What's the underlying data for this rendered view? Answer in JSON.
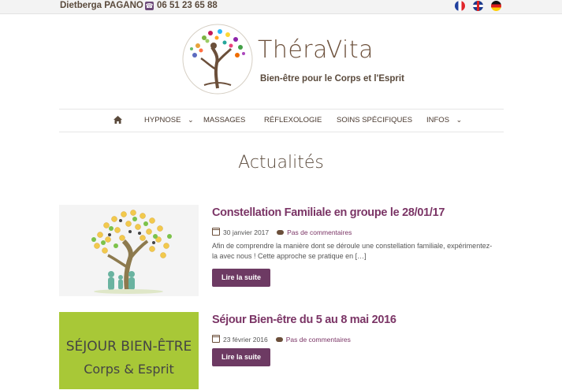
{
  "topbar": {
    "name": "Dietberga PAGANO",
    "phone": "06 51 23 65 88",
    "languages": [
      "Français",
      "English",
      "Deutsch"
    ]
  },
  "brand": {
    "name_part1": "Théra",
    "name_part2": "Vita",
    "tagline": "Bien-être pour le Corps et l'Esprit"
  },
  "nav": {
    "items": [
      {
        "label": "HYPNOSE",
        "has_dropdown": true
      },
      {
        "label": "MASSAGES",
        "has_dropdown": false
      },
      {
        "label": "RÉFLEXOLOGIE",
        "has_dropdown": false
      },
      {
        "label": "SOINS SPÉCIFIQUES",
        "has_dropdown": false
      },
      {
        "label": "INFOS",
        "has_dropdown": true
      }
    ],
    "chevron": "⌄"
  },
  "page": {
    "title": "Actualités"
  },
  "posts": [
    {
      "title": "Constellation Familiale en groupe le 28/01/17",
      "date": "30 janvier 2017",
      "comments": "Pas de commentaires",
      "excerpt": "Afin de comprendre la manière dont se déroule une constellation familiale, expérimentez-la avec nous ! Cette approche se pratique en […]",
      "button": "Lire la suite"
    },
    {
      "title": "Séjour Bien-être du 5 au 8 mai 2016",
      "date": "23 février 2016",
      "comments": "Pas de commentaires",
      "image_line1": "SÉJOUR BIEN-ÊTRE",
      "image_line2": "Corps & Esprit",
      "button": "Lire la suite"
    }
  ],
  "colors": {
    "accent": "#7b3566",
    "button": "#6d3a63",
    "text_brown": "#5a4a3c",
    "sejour_green": "#a8c837"
  }
}
